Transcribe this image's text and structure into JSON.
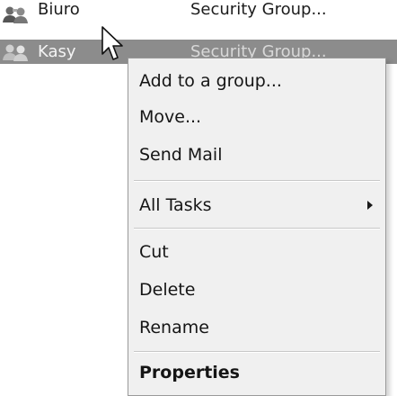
{
  "list": {
    "rows": [
      {
        "name": "Biuro",
        "type": "Security Group...",
        "icon": "group-icon",
        "selected": false
      },
      {
        "name": "Kasy",
        "type": "Security Group...",
        "icon": "group-icon",
        "selected": true
      }
    ]
  },
  "context_menu": {
    "items": [
      {
        "label": "Add to a group..."
      },
      {
        "label": "Move..."
      },
      {
        "label": "Send Mail"
      },
      {
        "label": "All Tasks",
        "submenu": true
      },
      {
        "label": "Cut"
      },
      {
        "label": "Delete"
      },
      {
        "label": "Rename"
      },
      {
        "label": "Properties",
        "bold": true
      }
    ]
  },
  "cursor": {
    "icon": "mouse-pointer-icon"
  },
  "colors": {
    "selection": "#8c8c8c",
    "menu_background": "#f0f0f0",
    "menu_border": "#9a9a9a"
  }
}
